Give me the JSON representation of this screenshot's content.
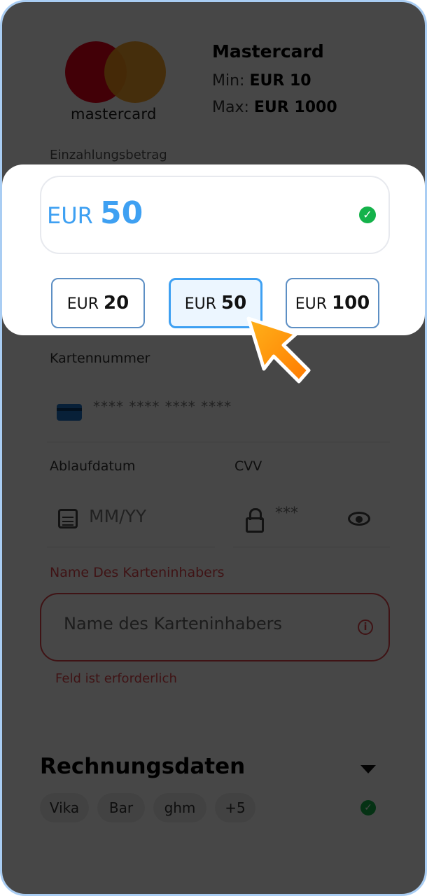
{
  "method": {
    "logo_text": "mastercard",
    "name": "Mastercard",
    "min_label": "Min:",
    "min_value": "EUR 10",
    "max_label": "Max:",
    "max_value": "EUR 1000"
  },
  "amount": {
    "label": "Einzahlungsbetrag",
    "currency": "EUR",
    "value": "50",
    "valid_icon": "check-circle-icon"
  },
  "quick_amounts": [
    {
      "currency": "EUR",
      "value": "20",
      "selected": false
    },
    {
      "currency": "EUR",
      "value": "50",
      "selected": true
    },
    {
      "currency": "EUR",
      "value": "100",
      "selected": false
    }
  ],
  "card": {
    "label": "Kartennummer",
    "placeholder": "**** **** **** ****",
    "icon": "credit-card-icon"
  },
  "expiry": {
    "label": "Ablaufdatum",
    "placeholder": "MM/YY",
    "icon": "calendar-icon"
  },
  "cvv": {
    "label": "CVV",
    "placeholder": "***",
    "icon": "lock-icon",
    "toggle_icon": "eye-icon"
  },
  "holder": {
    "label": "Name Des Karteninhabers",
    "placeholder": "Name des Karteninhabers",
    "error": "Feld ist erforderlich",
    "icon": "info-icon"
  },
  "billing": {
    "title": "Rechnungsdaten",
    "tags": [
      "Vika",
      "Bar",
      "ghm",
      "+5"
    ],
    "toggle_icon": "chevron-down-icon",
    "valid_icon": "check-circle-icon"
  },
  "colors": {
    "accent": "#3ea0f2",
    "error": "#e0464b",
    "success": "#14b24a",
    "frame": "#a9cdf3"
  }
}
